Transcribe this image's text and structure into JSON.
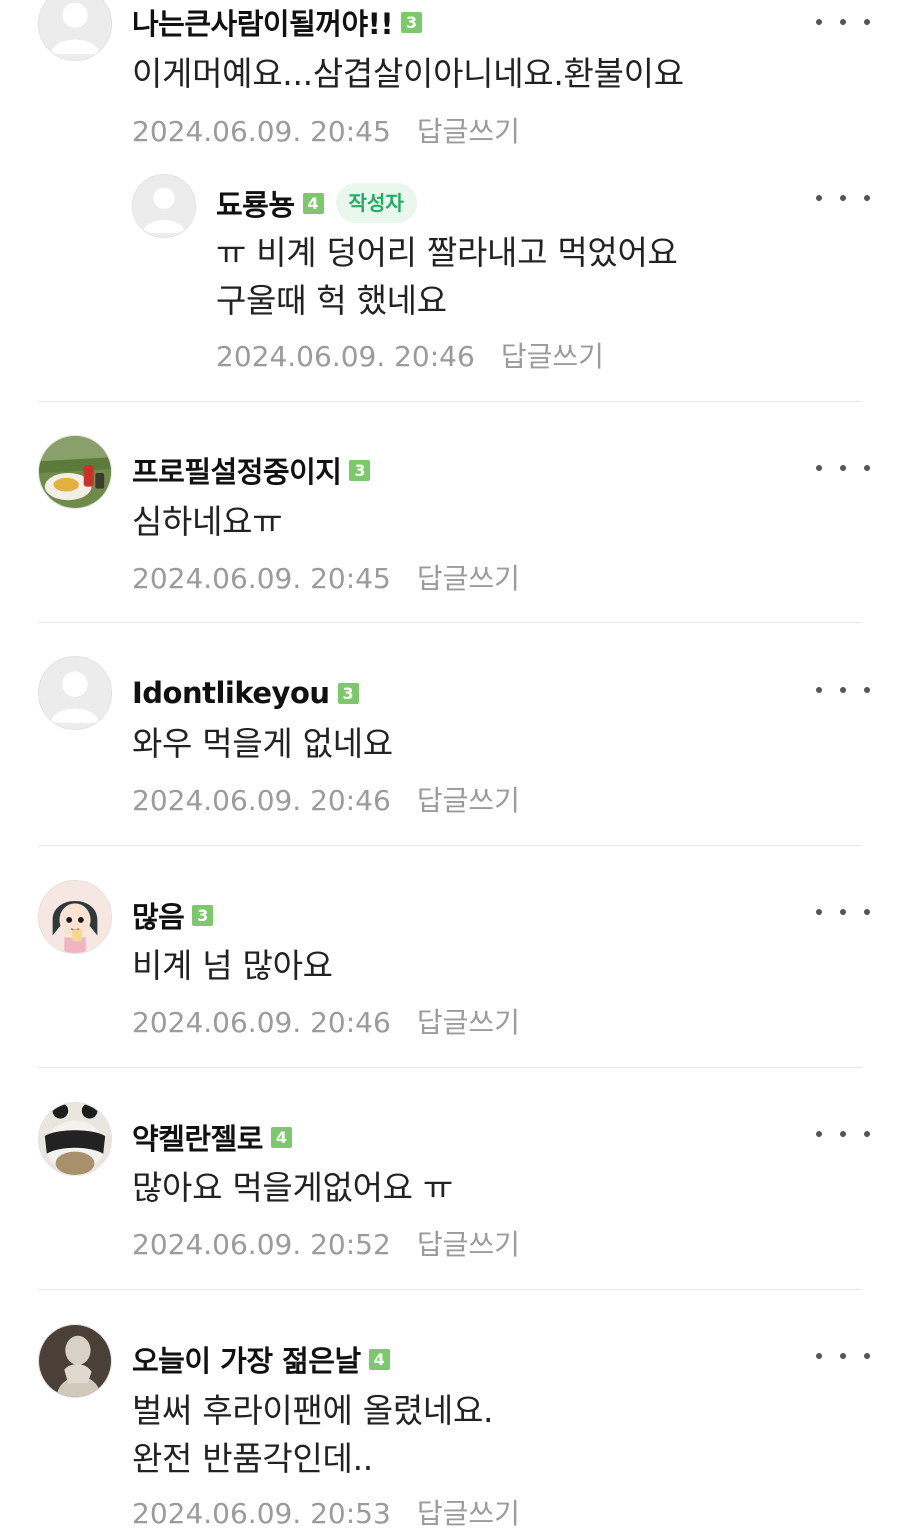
{
  "comments": [
    {
      "nickname": "나는큰사람이될꺼야!!",
      "level": "3",
      "text": "이게머예요...삼겹살이아니네요.환불이요",
      "date": "2024.06.09. 20:45",
      "reply_label": "답글쓰기",
      "avatar": "default-avatar"
    },
    {
      "nickname": "됴룡뇽",
      "level": "4",
      "author_badge": "작성자",
      "text": "ㅠ 비계 덩어리 짤라내고 먹었어요\n구울때 헉 했네요",
      "date": "2024.06.09. 20:46",
      "reply_label": "답글쓰기",
      "avatar": "default-avatar"
    },
    {
      "nickname": "프로필설정중이지",
      "level": "3",
      "text": "심하네요ㅠ",
      "date": "2024.06.09. 20:45",
      "reply_label": "답글쓰기",
      "avatar": "food-photo-avatar"
    },
    {
      "nickname": "Idontlikeyou",
      "level": "3",
      "text": "와우 먹을게 없네요",
      "date": "2024.06.09. 20:46",
      "reply_label": "답글쓰기",
      "avatar": "default-avatar"
    },
    {
      "nickname": "많음",
      "level": "3",
      "text": "비계 넘 많아요",
      "date": "2024.06.09. 20:46",
      "reply_label": "답글쓰기",
      "avatar": "cartoon-girl-avatar"
    },
    {
      "nickname": "약켈란젤로",
      "level": "4",
      "text": "많아요 먹을게없어요 ㅠ",
      "date": "2024.06.09. 20:52",
      "reply_label": "답글쓰기",
      "avatar": "panda-avatar"
    },
    {
      "nickname": "오늘이 가장 젊은날",
      "level": "4",
      "text": "벌써 후라이팬에 올렸네요.\n완전 반품각인데..",
      "date": "2024.06.09. 20:53",
      "reply_label": "답글쓰기",
      "avatar": "statue-photo-avatar"
    }
  ],
  "colors": {
    "level_badge": "#7cc86a",
    "author_badge_bg": "#e9f7ee",
    "author_badge_text": "#1fae5f",
    "meta_text": "#9b9b9b"
  }
}
